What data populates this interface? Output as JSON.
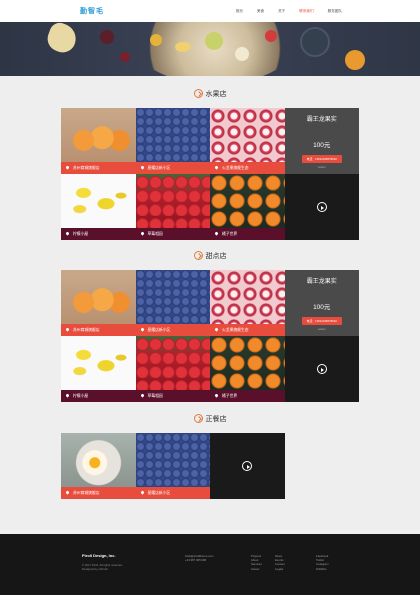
{
  "header": {
    "logo": "勤智毛",
    "nav": [
      {
        "label": "首页",
        "active": false
      },
      {
        "label": "美食",
        "active": false
      },
      {
        "label": "关于",
        "active": false
      },
      {
        "label": "联系我们",
        "active": true
      },
      {
        "label": "服务团队",
        "active": false
      }
    ]
  },
  "sections": [
    {
      "title": "水果店",
      "tiles": [
        {
          "label": "苏州商城旗舰店"
        },
        {
          "label": "星耀店新小区"
        },
        {
          "label": "火龙果旗舰生态"
        },
        {
          "label": "柠檬小屋"
        },
        {
          "label": "草莓相园"
        },
        {
          "label": "橘子世界"
        }
      ],
      "promo": {
        "title": "霸王龙果实",
        "price": "100元",
        "button": "电话：13812345678910",
        "sub": "Lorem"
      }
    },
    {
      "title": "甜点店",
      "tiles": [
        {
          "label": "苏州商城旗舰店"
        },
        {
          "label": "星耀店新小区"
        },
        {
          "label": "火龙果旗舰生态"
        },
        {
          "label": "柠檬小屋"
        },
        {
          "label": "草莓相园"
        },
        {
          "label": "橘子世界"
        }
      ],
      "promo": {
        "title": "霸王龙果实",
        "price": "100元",
        "button": "电话：13812345678910",
        "sub": "Lorem"
      }
    },
    {
      "title": "正餐店",
      "tiles": [
        {
          "label": "苏州商城旗舰店"
        },
        {
          "label": "星耀店新小区"
        }
      ]
    }
  ],
  "footer": {
    "company": "Piroll Design, Inc.",
    "copyright": [
      "© 2017 Piroll. All rights reserved.",
      "Designed by robirurk"
    ],
    "contact": [
      "hello@pirolltheme.com",
      "+44 987 065 908"
    ],
    "links1": [
      "Projects",
      "About",
      "Services",
      "Career"
    ],
    "links2": [
      "News",
      "Events",
      "Contact",
      "Legals"
    ],
    "links3": [
      "Facebook",
      "Twitter",
      "Instagram",
      "Dribbble"
    ]
  }
}
